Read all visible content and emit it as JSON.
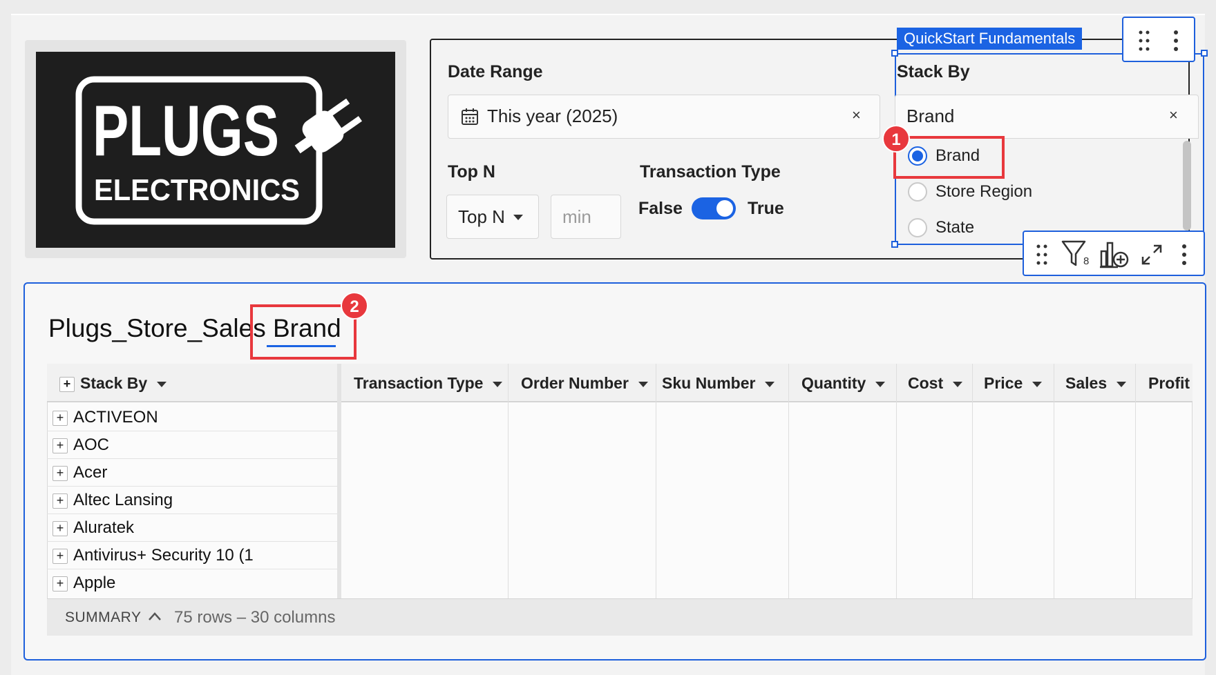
{
  "logo": {
    "line1": "PLUGS",
    "line2": "ELECTRONICS"
  },
  "date_range": {
    "label": "Date Range",
    "value": "This year (2025)",
    "clear": "×"
  },
  "top_n": {
    "label": "Top N",
    "select_value": "Top N",
    "min_placeholder": "min"
  },
  "transaction_type": {
    "label": "Transaction Type",
    "off_label": "False",
    "on_label": "True",
    "state": true
  },
  "stack_by": {
    "tag": "QuickStart Fundamentals",
    "label": "Stack By",
    "value": "Brand",
    "clear": "×",
    "options": [
      {
        "label": "Brand",
        "selected": true
      },
      {
        "label": "Store Region",
        "selected": false
      },
      {
        "label": "State",
        "selected": false
      }
    ]
  },
  "element_toolbar": {
    "filter_count": "8"
  },
  "annotations": {
    "badge1": "1",
    "badge2": "2",
    "color": "#e8383d"
  },
  "table": {
    "title_prefix": "Plugs_Store_Sales",
    "title_suffix": "Brand",
    "columns": [
      "Stack By",
      "Transaction Type",
      "Order Number",
      "Sku Number",
      "Quantity",
      "Cost",
      "Price",
      "Sales",
      "Profit"
    ],
    "rows": [
      "ACTIVEON",
      "AOC",
      "Acer",
      "Altec Lansing",
      "Aluratek",
      "Antivirus+ Security 10 (1",
      "Apple"
    ],
    "summary_label": "SUMMARY",
    "summary_text": "75 rows – 30 columns"
  },
  "colors": {
    "accent": "#1b63e3",
    "highlight": "#e8383d"
  }
}
